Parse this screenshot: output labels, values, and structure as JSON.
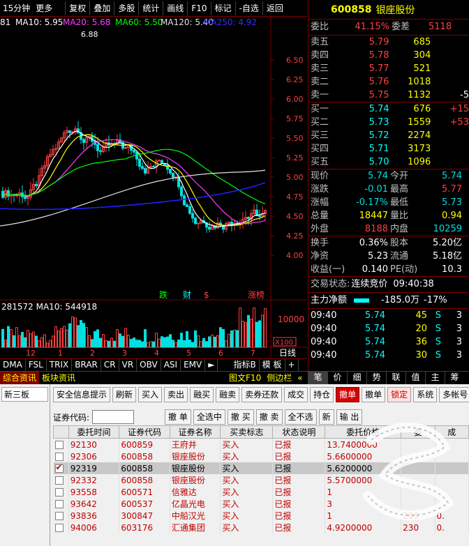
{
  "toolbar": {
    "period": "15分钟",
    "more": "更多",
    "buttons": [
      "复权",
      "叠加",
      "多股",
      "统计",
      "画线",
      "F10",
      "标记",
      "-自选",
      "返回"
    ]
  },
  "ma_line": {
    "head": "81",
    "ma10": "MA10: 5.95",
    "ma20": "MA20: 5.68",
    "ma60": "MA60: 5.50",
    "ma120": "MA120: 5.40",
    "ma250": "MA250: 4.92"
  },
  "chart": {
    "high_label": "6.88",
    "price_axis": [
      "6.50",
      "6.25",
      "6.00",
      "5.75",
      "5.50",
      "5.25",
      "5.00",
      "4.75",
      "4.50",
      "4.25",
      "4.00"
    ],
    "vol_header": "281572  MA10: 544918",
    "vol_axis": [
      "10000"
    ],
    "vol_unit": "X100",
    "date_labels": [
      "12",
      "1",
      "2",
      "3",
      "4",
      "5",
      "6",
      "7"
    ],
    "markers": [
      "跌",
      "财",
      "$",
      "涨榜"
    ],
    "day_line": "日线"
  },
  "indicator_tabs": [
    "DMA",
    "FSL",
    "TRIX",
    "BRAR",
    "CR",
    "VR",
    "OBV",
    "ASI",
    "EMV",
    "►",
    "指标B",
    "模 板",
    "+"
  ],
  "sub_tabs": [
    "综合资讯",
    "板块资讯",
    "图文F10",
    "侧边栏",
    "«"
  ],
  "right_tabs": [
    "笔",
    "价",
    "细",
    "势",
    "联",
    "值",
    "主",
    "筹"
  ],
  "quote": {
    "code": "600858",
    "name": "银座股份",
    "weibi_label": "委比",
    "weibi": "41.15%",
    "weicha_label": "委差",
    "weicha": "5118",
    "sells": [
      {
        "label": "卖五",
        "price": "5.79",
        "vol": "685",
        "extra": ""
      },
      {
        "label": "卖四",
        "price": "5.78",
        "vol": "304",
        "extra": ""
      },
      {
        "label": "卖三",
        "price": "5.77",
        "vol": "521",
        "extra": ""
      },
      {
        "label": "卖二",
        "price": "5.76",
        "vol": "1018",
        "extra": ""
      },
      {
        "label": "卖一",
        "price": "5.75",
        "vol": "1132",
        "extra": "-5"
      }
    ],
    "buys": [
      {
        "label": "买一",
        "price": "5.74",
        "vol": "676",
        "extra": "+15"
      },
      {
        "label": "买二",
        "price": "5.73",
        "vol": "1559",
        "extra": "+53"
      },
      {
        "label": "买三",
        "price": "5.72",
        "vol": "2274",
        "extra": ""
      },
      {
        "label": "买四",
        "price": "5.71",
        "vol": "3173",
        "extra": ""
      },
      {
        "label": "买五",
        "price": "5.70",
        "vol": "1096",
        "extra": ""
      }
    ],
    "stats": [
      {
        "l1": "现价",
        "v1": "5.74",
        "c1": "green",
        "l2": "今开",
        "v2": "5.74",
        "c2": "green"
      },
      {
        "l1": "涨跌",
        "v1": "-0.01",
        "c1": "green",
        "l2": "最高",
        "v2": "5.77",
        "c2": "red"
      },
      {
        "l1": "涨幅",
        "v1": "-0.17%",
        "c1": "green",
        "l2": "最低",
        "v2": "5.73",
        "c2": "green"
      },
      {
        "l1": "总量",
        "v1": "18447",
        "c1": "yellow",
        "l2": "量比",
        "v2": "0.94",
        "c2": "yellow"
      },
      {
        "l1": "外盘",
        "v1": "8188",
        "c1": "red",
        "l2": "内盘",
        "v2": "10259",
        "c2": "green"
      }
    ],
    "stats2": [
      {
        "l1": "换手",
        "v1": "0.36%",
        "l2": "股本",
        "v2": "5.20亿"
      },
      {
        "l1": "净资",
        "v1": "5.23",
        "l2": "流通",
        "v2": "5.18亿"
      },
      {
        "l1": "收益(一)",
        "v1": "0.140",
        "l2": "PE(动)",
        "v2": "10.3"
      }
    ],
    "status_label": "交易状态:",
    "status": "连续竞价",
    "status_time": "09:40:38",
    "net_label": "主力净额",
    "net_value": "-185.0万",
    "net_pct": "-17%",
    "ticks": [
      {
        "t": "09:40",
        "p": "5.74",
        "v": "45",
        "s": "S",
        "n": "3"
      },
      {
        "t": "09:40",
        "p": "5.74",
        "v": "20",
        "s": "S",
        "n": "3"
      },
      {
        "t": "09:40",
        "p": "5.74",
        "v": "36",
        "s": "S",
        "n": "3"
      },
      {
        "t": "09:40",
        "p": "5.74",
        "v": "30",
        "s": "S",
        "n": "3"
      }
    ]
  },
  "trade": {
    "side_tab": "新三板",
    "buttons": [
      "安全信息提示",
      "刷新",
      "买入",
      "卖出",
      "融买",
      "融卖",
      "卖券还款",
      "成交",
      "持仓",
      "撤单",
      "撤单",
      "锁定",
      "系统",
      "多帐号"
    ],
    "code_label": "证券代码:",
    "row2_buttons": [
      "撤 单",
      "全选中",
      "撤 买",
      "撤 卖",
      "全不选",
      "新",
      "输 出"
    ],
    "columns": [
      "",
      "委托时间",
      "证券代码",
      "证券名称",
      "买卖标志",
      "状态说明",
      "委托价格",
      "委",
      "成"
    ],
    "rows": [
      {
        "checked": false,
        "time": "92130",
        "code": "600859",
        "name": "王府井",
        "side": "买入",
        "status": "已报",
        "price": "13.7400000",
        "q": "",
        "f": ""
      },
      {
        "checked": false,
        "time": "92306",
        "code": "600858",
        "name": "银座股份",
        "side": "买入",
        "status": "已报",
        "price": "5.6600000",
        "q": "",
        "f": ""
      },
      {
        "checked": true,
        "time": "92319",
        "code": "600858",
        "name": "银座股份",
        "side": "买入",
        "status": "已报",
        "price": "5.6200000",
        "q": "",
        "f": ""
      },
      {
        "checked": false,
        "time": "92332",
        "code": "600858",
        "name": "银座股份",
        "side": "买入",
        "status": "已报",
        "price": "5.5700000",
        "q": "",
        "f": ""
      },
      {
        "checked": false,
        "time": "93558",
        "code": "600571",
        "name": "信雅达",
        "side": "买入",
        "status": "已报",
        "price": "1",
        "q": "",
        "f": ""
      },
      {
        "checked": false,
        "time": "93642",
        "code": "600537",
        "name": "亿晶光电",
        "side": "买入",
        "status": "已报",
        "price": "3",
        "q": "",
        "f": ""
      },
      {
        "checked": false,
        "time": "93836",
        "code": "300847",
        "name": "中船汉光",
        "side": "买入",
        "status": "已报",
        "price": "1",
        "q": "209",
        "f": "0."
      },
      {
        "checked": false,
        "time": "94006",
        "code": "603176",
        "name": "汇通集团",
        "side": "买入",
        "status": "已报",
        "price": "4.9200000",
        "q": "230",
        "f": "0."
      }
    ]
  },
  "colors": {
    "up": "#ff4040",
    "down": "#00e0e0",
    "ma10": "#ffffff",
    "ma20": "#ff40ff",
    "ma60": "#00ff00",
    "ma120": "#e0e0e0",
    "ma250": "#2020ff",
    "border": "#800000"
  }
}
